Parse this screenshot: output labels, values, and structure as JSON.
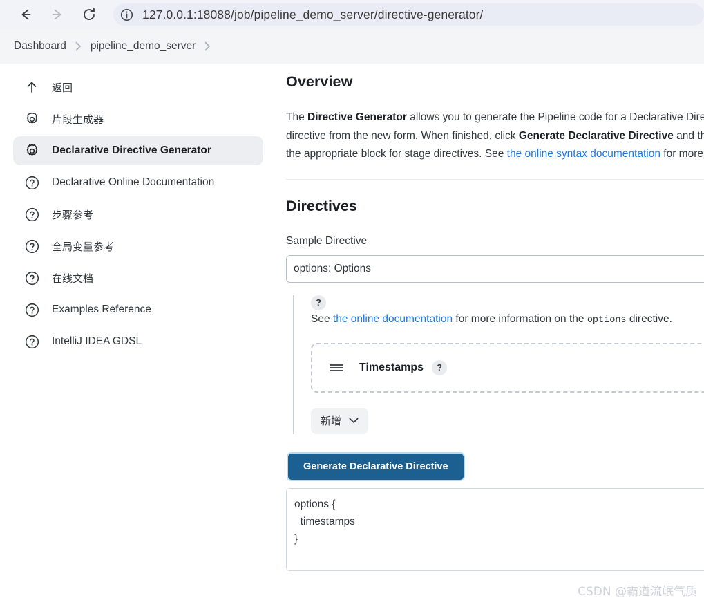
{
  "browser": {
    "back_icon": "back-arrow-icon",
    "forward_icon": "forward-arrow-icon",
    "reload_icon": "reload-icon",
    "site_info_icon": "info-circle-icon",
    "url": "127.0.0.1:18088/job/pipeline_demo_server/directive-generator/"
  },
  "breadcrumb": {
    "items": [
      {
        "label": "Dashboard"
      },
      {
        "label": "pipeline_demo_server"
      }
    ],
    "separator": "›"
  },
  "sidebar": {
    "items": [
      {
        "label": "返回",
        "icon": "up-arrow-icon",
        "cjk": true,
        "selected": false
      },
      {
        "label": "片段生成器",
        "icon": "gear-icon",
        "cjk": true,
        "selected": false
      },
      {
        "label": "Declarative Directive Generator",
        "icon": "gear-icon",
        "cjk": false,
        "selected": true
      },
      {
        "label": "Declarative Online Documentation",
        "icon": "question-circle-icon",
        "cjk": false,
        "selected": false
      },
      {
        "label": "步骤参考",
        "icon": "question-circle-icon",
        "cjk": true,
        "selected": false
      },
      {
        "label": "全局变量参考",
        "icon": "question-circle-icon",
        "cjk": true,
        "selected": false
      },
      {
        "label": "在线文档",
        "icon": "question-circle-icon",
        "cjk": true,
        "selected": false
      },
      {
        "label": "Examples Reference",
        "icon": "question-circle-icon",
        "cjk": false,
        "selected": false
      },
      {
        "label": "IntelliJ IDEA GDSL",
        "icon": "question-circle-icon",
        "cjk": false,
        "selected": false
      }
    ]
  },
  "main": {
    "overview_title": "Overview",
    "overview_paragraph": {
      "part1": "The ",
      "bold1": "Directive Generator",
      "part2": " allows you to generate the Pipeline code for a Declarative Directive. Choose a directive from the dropdown, and then choose the contents of the directive from the new form. When finished, click ",
      "bold2": "Generate Declarative Directive",
      "part3": " and the Pipeline code will appear in the box below. You can then copy and paste that into the appropriate block for stage directives. See ",
      "link_text": "the online syntax documentation",
      "part4": " for more information."
    },
    "directives_title": "Directives",
    "sample_directive_label": "Sample Directive",
    "sample_directive_value": "options: Options",
    "help": {
      "badge": "?",
      "part1": "See ",
      "link_text": "the online documentation",
      "part2": " for more information on the ",
      "code": "options",
      "part3": " directive."
    },
    "timestamps_card": {
      "drag_icon": "drag-handle-icon",
      "title": "Timestamps",
      "help_badge": "?"
    },
    "add_button": {
      "label": "新增",
      "chevron_icon": "chevron-down-icon"
    },
    "generate_button_label": "Generate Declarative Directive",
    "generated_code": "options {\n  timestamps\n}"
  },
  "watermark": "CSDN @霸道流氓气质",
  "colors": {
    "accent_blue": "#1e7ae6",
    "button_blue": "#1c6091",
    "chrome_bg": "#f1f3f8",
    "breadcrumb_bg": "#f4f5f7",
    "selected_item_bg": "#eceef1"
  }
}
